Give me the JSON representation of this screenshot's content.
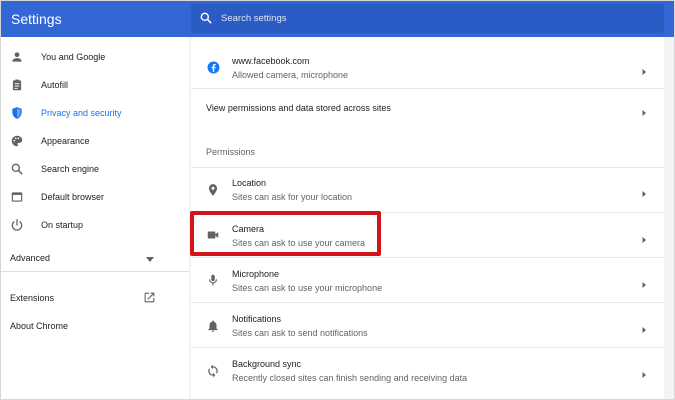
{
  "app": {
    "title": "Settings"
  },
  "search": {
    "placeholder": "Search settings"
  },
  "sidebar": {
    "items": [
      {
        "label": "You and Google",
        "icon": "person-icon"
      },
      {
        "label": "Autofill",
        "icon": "clipboard-icon"
      },
      {
        "label": "Privacy and security",
        "icon": "shield-icon"
      },
      {
        "label": "Appearance",
        "icon": "palette-icon"
      },
      {
        "label": "Search engine",
        "icon": "search-icon"
      },
      {
        "label": "Default browser",
        "icon": "browser-icon"
      },
      {
        "label": "On startup",
        "icon": "power-icon"
      }
    ],
    "advanced": "Advanced",
    "extensions": "Extensions",
    "about": "About Chrome"
  },
  "main": {
    "site": {
      "title": "www.facebook.com",
      "subtitle": "Allowed camera, microphone"
    },
    "view_permissions": "View permissions and data stored across sites",
    "permissions_heading": "Permissions",
    "permissions": [
      {
        "title": "Location",
        "subtitle": "Sites can ask for your location",
        "icon": "location-pin-icon"
      },
      {
        "title": "Camera",
        "subtitle": "Sites can ask to use your camera",
        "icon": "camera-icon"
      },
      {
        "title": "Microphone",
        "subtitle": "Sites can ask to use your microphone",
        "icon": "microphone-icon"
      },
      {
        "title": "Notifications",
        "subtitle": "Sites can ask to send notifications",
        "icon": "bell-icon"
      },
      {
        "title": "Background sync",
        "subtitle": "Recently closed sites can finish sending and receiving data",
        "icon": "sync-icon"
      }
    ]
  },
  "colors": {
    "brand": "#3367d6",
    "active": "#1a73e8",
    "highlight": "#d3151b",
    "background": "#f1f3f4",
    "facebook": "#1877f2"
  }
}
